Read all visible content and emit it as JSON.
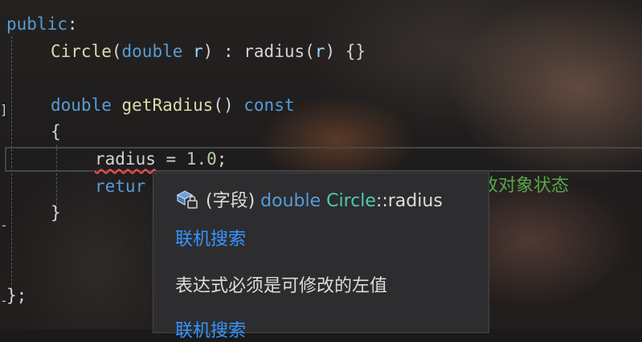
{
  "editor": {
    "lines": {
      "l1": {
        "kw": "public",
        "colon": ":"
      },
      "l2": {
        "ctor": "Circle",
        "open": "(",
        "type": "double",
        "param": " r",
        "close": ")",
        "init_sep": " : ",
        "member": "radius",
        "iopen": "(",
        "iparam": "r",
        "iclose": ")",
        "body": " {}"
      },
      "l3": {
        "type": "double",
        "fn": "getRadius",
        "parens": "()",
        "qual": "const"
      },
      "l4": {
        "brace": "{"
      },
      "l5": {
        "member": "radius",
        "op": " = ",
        "num": "1.0",
        "semi": ";"
      },
      "l6": {
        "kw": "retur"
      },
      "l7": {
        "brace": "}"
      },
      "l8": {
        "close": "};"
      }
    },
    "comment_fragment": "改对象状态"
  },
  "tooltip": {
    "signature_prefix": "(字段) ",
    "signature_type": "double",
    "signature_class": "Circle",
    "signature_sep": "::",
    "signature_member": "radius",
    "search_link_1": "联机搜索",
    "error_message": "表达式必须是可修改的左值",
    "search_link_2": "联机搜索"
  },
  "colors": {
    "keyword": "#569cd6",
    "function": "#dcdcaa",
    "type_class": "#4ec9b0",
    "number": "#b5cea8",
    "comment": "#57a64a",
    "link": "#3794ff",
    "error_squiggle": "#f14c4c",
    "popup_bg": "#2d2d30"
  }
}
